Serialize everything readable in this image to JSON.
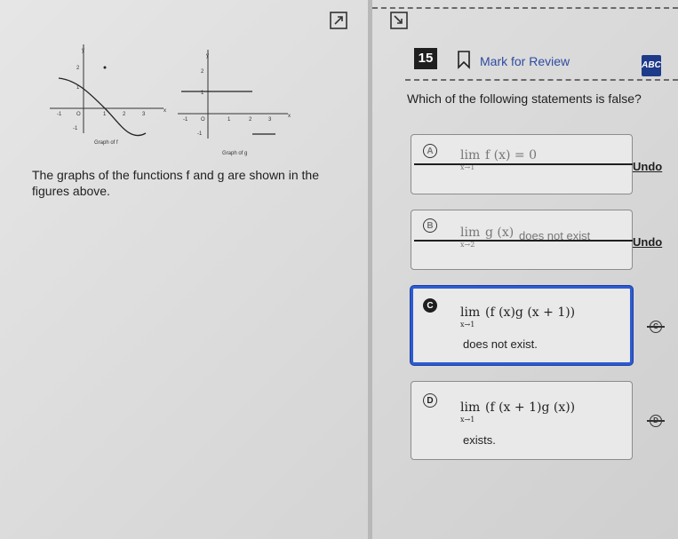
{
  "toolbar": {
    "icons": [
      "expand-icon",
      "collapse-icon"
    ]
  },
  "stimulus": {
    "graph_f_caption": "Graph of f",
    "graph_g_caption": "Graph of g",
    "text": "The graphs of the functions f and g are shown in the figures above.",
    "ticks_f": {
      "x": [
        "-1",
        "O",
        "1",
        "2",
        "3"
      ],
      "y": [
        "2",
        "1",
        "-1"
      ],
      "x_axis": "x",
      "y_axis": "y"
    },
    "ticks_g": {
      "x": [
        "-1",
        "O",
        "1",
        "2",
        "3"
      ],
      "y": [
        "2",
        "1",
        "-1"
      ],
      "x_axis": "x",
      "y_axis": "y"
    }
  },
  "question": {
    "number": "15",
    "mark_label": "Mark for Review",
    "abc_label": "ABC",
    "prompt": "Which of the following statements is false?"
  },
  "choices": [
    {
      "letter": "A",
      "lim": "lim",
      "sub": "x→1",
      "expr": "f (x) = 0",
      "suffix": "",
      "eliminated": true,
      "undo": "Undo"
    },
    {
      "letter": "B",
      "lim": "lim",
      "sub": "x→2",
      "expr": "g (x)",
      "suffix": "does not exist",
      "eliminated": true,
      "undo": "Undo"
    },
    {
      "letter": "C",
      "lim": "lim",
      "sub": "x→1",
      "expr": "(f (x)g (x + 1))",
      "line2": "does not exist.",
      "selected": true,
      "elim": "C"
    },
    {
      "letter": "D",
      "lim": "lim",
      "sub": "x→1",
      "expr": "(f (x + 1)g (x))",
      "line2": "exists.",
      "selected": false,
      "elim": "D"
    }
  ]
}
